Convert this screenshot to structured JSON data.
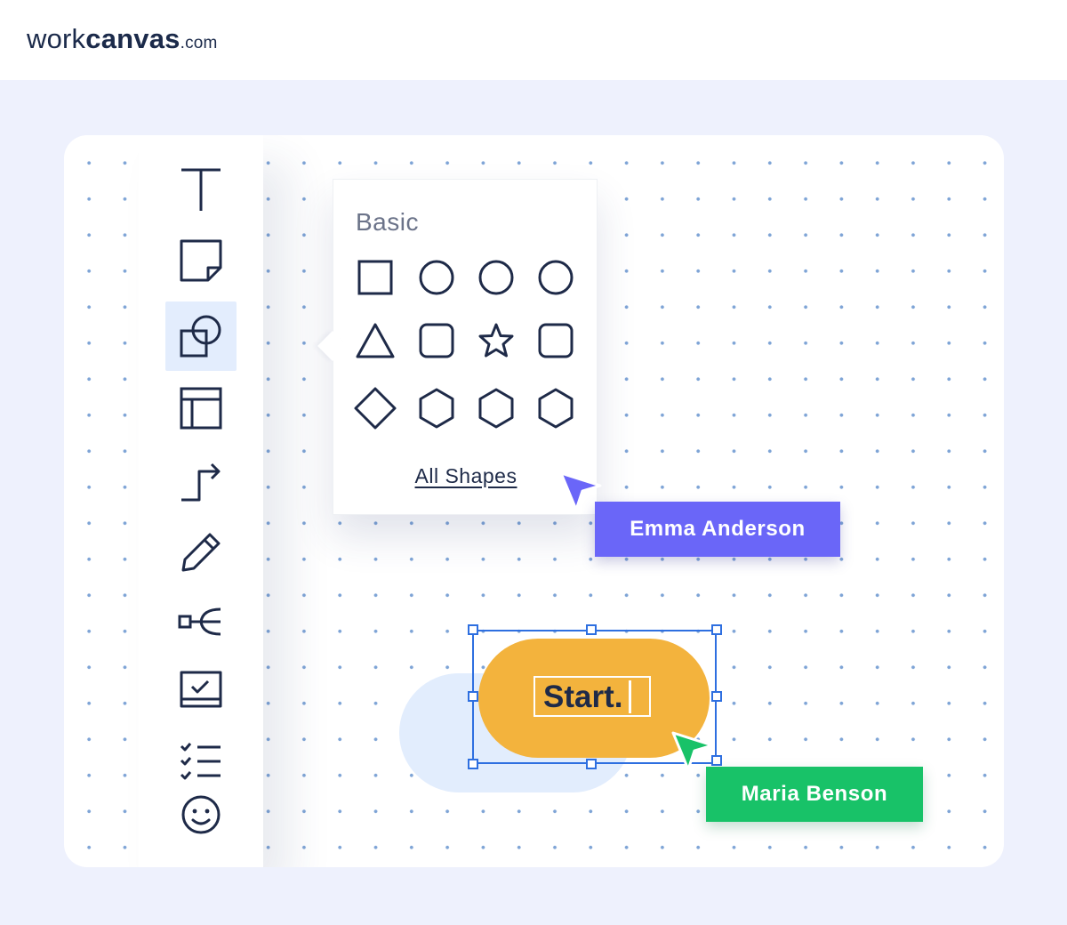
{
  "brand": {
    "prefix": "work",
    "name": "canvas",
    "suffix": ".com"
  },
  "toolbar": {
    "tools": [
      {
        "name": "text-tool",
        "icon": "text-t-icon"
      },
      {
        "name": "sticky-note-tool",
        "icon": "sticky-note-icon"
      },
      {
        "name": "shapes-tool",
        "icon": "shapes-icon",
        "active": true
      },
      {
        "name": "frame-tool",
        "icon": "frame-layout-icon"
      },
      {
        "name": "connector-tool",
        "icon": "connector-arrow-icon"
      },
      {
        "name": "pen-tool",
        "icon": "pencil-icon"
      },
      {
        "name": "mind-map-tool",
        "icon": "mind-map-icon"
      },
      {
        "name": "template-tool",
        "icon": "board-check-icon"
      },
      {
        "name": "checklist-tool",
        "icon": "checklist-icon"
      },
      {
        "name": "emoji-tool",
        "icon": "smiley-icon"
      }
    ]
  },
  "shapes_panel": {
    "title": "Basic",
    "shapes": [
      "square",
      "circle",
      "circle",
      "circle",
      "triangle",
      "rounded-square",
      "star",
      "rounded-square",
      "diamond",
      "hexagon",
      "hexagon",
      "hexagon"
    ],
    "link_label": "All Shapes"
  },
  "canvas": {
    "start_node": {
      "text": "Start.",
      "fill": "#f3b33d"
    },
    "selection_color": "#2e6fe0"
  },
  "collaborators": [
    {
      "name": "Emma Anderson",
      "color": "#6a66f8"
    },
    {
      "name": "Maria Benson",
      "color": "#18c268"
    }
  ],
  "colors": {
    "ink": "#1e2a48",
    "page_background": "#eef1fd",
    "grid_dot": "#7ea4d6",
    "active_tool_bg": "#e3edfd"
  }
}
